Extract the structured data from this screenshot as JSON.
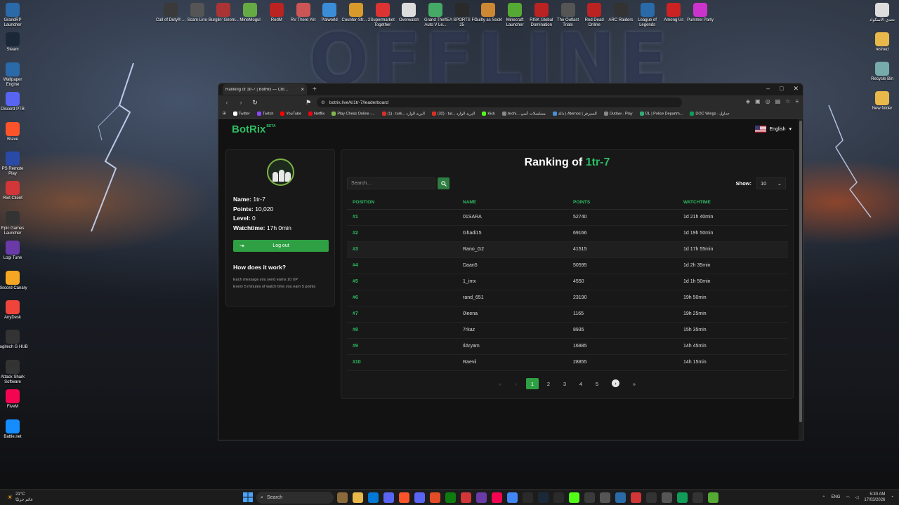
{
  "desktop": {
    "wallpaper_text": "OFFLINE",
    "top_icons": [
      {
        "label": "Call of Duty® ...",
        "color": "#3a3a3a"
      },
      {
        "label": "Scam Line",
        "color": "#555"
      },
      {
        "label": "Burglin' Gnom...",
        "color": "#a33"
      },
      {
        "label": "MineMogul",
        "color": "#6a4"
      },
      {
        "label": "RedM",
        "color": "#b22"
      },
      {
        "label": "RV There Yet",
        "color": "#c55"
      },
      {
        "label": "Palworld",
        "color": "#3a8dd6"
      },
      {
        "label": "Counter-Str... 2",
        "color": "#d89b2b"
      },
      {
        "label": "Supermarket Together",
        "color": "#d33"
      },
      {
        "label": "Overwatch",
        "color": "#ddd"
      },
      {
        "label": "Grand Theft Auto V Le...",
        "color": "#4a6"
      },
      {
        "label": "EA SPORTS FC 25",
        "color": "#2a2a2a"
      },
      {
        "label": "Guilty as Sock!",
        "color": "#c83"
      },
      {
        "label": "Minecraft Launcher",
        "color": "#5a3"
      },
      {
        "label": "RISK Global Domination",
        "color": "#b22"
      },
      {
        "label": "The Outlast Trials",
        "color": "#555"
      },
      {
        "label": "Red Dead Online",
        "color": "#b22"
      },
      {
        "label": "ARC Raiders",
        "color": "#333"
      },
      {
        "label": "League of Legends",
        "color": "#2a6aa8"
      },
      {
        "label": "Among Us",
        "color": "#c22"
      },
      {
        "label": "Pummel Party",
        "color": "#c3c"
      }
    ],
    "left_icons": [
      {
        "label": "GrandRP Launcher",
        "color": "#2a6aa8"
      },
      {
        "label": "Steam",
        "color": "#1b2838"
      },
      {
        "label": "Wallpaper Engine",
        "color": "#2a6aa8"
      },
      {
        "label": "Discord PTB",
        "color": "#5865f2"
      },
      {
        "label": "Brave",
        "color": "#fb542b"
      },
      {
        "label": "PS Remote Play",
        "color": "#2a4aa8"
      },
      {
        "label": "Riot Client",
        "color": "#d13639"
      },
      {
        "label": "Epic Games Launcher",
        "color": "#333"
      },
      {
        "label": "Logi Tune",
        "color": "#6a3aa8"
      },
      {
        "label": "Discord Canary",
        "color": "#f5a623"
      },
      {
        "label": "AnyDesk",
        "color": "#ef443b"
      },
      {
        "label": "Logitech G HUB",
        "color": "#333"
      },
      {
        "label": "Attack Shark Software",
        "color": "#333"
      },
      {
        "label": "FiveM",
        "color": "#f40552"
      },
      {
        "label": "Battle.net",
        "color": "#148eff"
      }
    ],
    "right_icons": [
      {
        "label": "تحدي الأسكواد",
        "color": "#ddd"
      },
      {
        "label": "reshed",
        "color": "#e8b84a"
      },
      {
        "label": "Recycle Bin",
        "color": "#7aa"
      },
      {
        "label": "New folder",
        "color": "#e8b84a"
      }
    ]
  },
  "browser": {
    "tab_title": "Ranking of 1tr-7 | BotRix — Chr...",
    "url": "botrix.live/k/1tr-7/leaderboard",
    "bookmarks": [
      {
        "label": "Twitter",
        "color": "#fff"
      },
      {
        "label": "Twitch",
        "color": "#9146ff"
      },
      {
        "label": "YouTube",
        "color": "#f00"
      },
      {
        "label": "Netflix",
        "color": "#e50914"
      },
      {
        "label": "Play Chess Online -...",
        "color": "#81b64c"
      },
      {
        "label": "(1) - turk... البريد الوارد",
        "color": "#d93025"
      },
      {
        "label": "(32) - tur... البريد الوارد",
        "color": "#d93025"
      },
      {
        "label": "Kick",
        "color": "#53fc18"
      },
      {
        "label": "Archi... مسلسلات أنمي",
        "color": "#888"
      },
      {
        "label": "دالة | Aternos | السيرفر",
        "color": "#4a90d9"
      },
      {
        "label": "Outlaw - Play",
        "color": "#888"
      },
      {
        "label": "OL | Police Departm...",
        "color": "#3a7"
      },
      {
        "label": "DOC Wings - جداول",
        "color": "#0f9d58"
      }
    ]
  },
  "site": {
    "logo": "BotRix",
    "beta": "BETA",
    "language": "English"
  },
  "profile": {
    "name_label": "Name:",
    "name": "1tr-7",
    "points_label": "Points:",
    "points": "10,020",
    "level_label": "Level:",
    "level": "0",
    "watchtime_label": "Watchtime:",
    "watchtime": "17h 0min",
    "logout": "Log out",
    "how_title": "How does it work?",
    "how_line1": "Each message you send earns 10 XP",
    "how_line2": "Every 5 minutes of watch time you earn 5 points"
  },
  "ranking": {
    "title_prefix": "Ranking of",
    "title_user": "1tr-7",
    "search_placeholder": "Search...",
    "show_label": "Show:",
    "show_value": "10",
    "columns": [
      "POSITION",
      "NAME",
      "POINTS",
      "WATCHTIME"
    ],
    "rows": [
      {
        "pos": "#1",
        "name": "01SARA",
        "points": "52740",
        "watch": "1d 21h 40min"
      },
      {
        "pos": "#2",
        "name": "Ghadi15",
        "points": "69166",
        "watch": "1d 19h 50min"
      },
      {
        "pos": "#3",
        "name": "Rano_G2",
        "points": "41515",
        "watch": "1d 17h 55min"
      },
      {
        "pos": "#4",
        "name": "Daan5",
        "points": "50595",
        "watch": "1d 2h 35min"
      },
      {
        "pos": "#5",
        "name": "1_imx",
        "points": "4550",
        "watch": "1d 1h 50min"
      },
      {
        "pos": "#6",
        "name": "rand_651",
        "points": "23190",
        "watch": "19h 50min"
      },
      {
        "pos": "#7",
        "name": "0leena",
        "points": "1165",
        "watch": "19h 25min"
      },
      {
        "pos": "#8",
        "name": "7rkaz",
        "points": "8935",
        "watch": "15h 35min"
      },
      {
        "pos": "#9",
        "name": "IlAryam",
        "points": "16885",
        "watch": "14h 45min"
      },
      {
        "pos": "#10",
        "name": "Raevii",
        "points": "28855",
        "watch": "14h 15min"
      }
    ],
    "pages": [
      "1",
      "2",
      "3",
      "4",
      "5"
    ]
  },
  "taskbar": {
    "search": "Search",
    "temp": "21°C",
    "weather": "غائم جزئيًا",
    "lang": "ENG",
    "time": "5:30 AM",
    "date": "17/03/2026"
  }
}
